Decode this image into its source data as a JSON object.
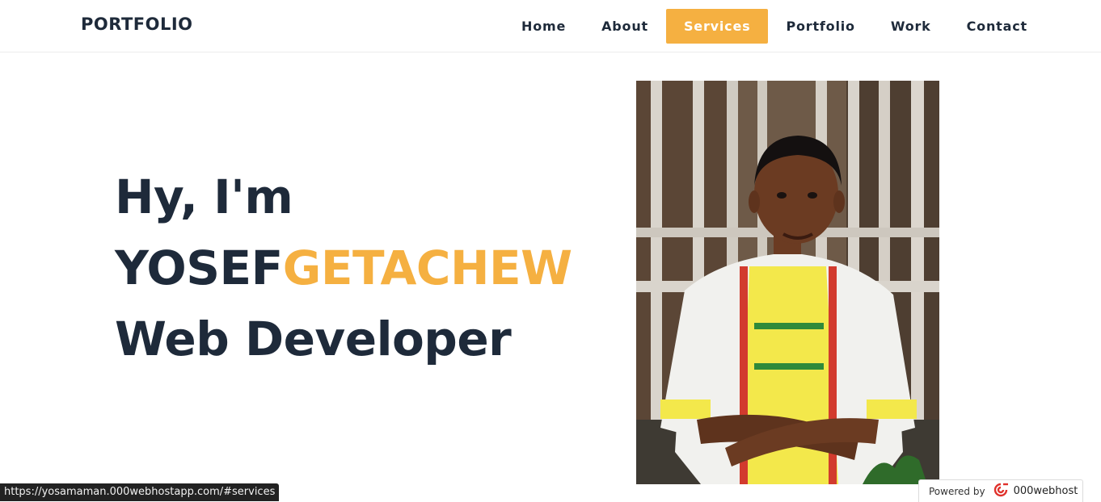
{
  "header": {
    "brand": "PORTFOLIO",
    "nav": [
      {
        "label": "Home",
        "active": false
      },
      {
        "label": "About",
        "active": false
      },
      {
        "label": "Services",
        "active": true
      },
      {
        "label": "Portfolio",
        "active": false
      },
      {
        "label": "Work",
        "active": false
      },
      {
        "label": "Contact",
        "active": false
      }
    ]
  },
  "hero": {
    "greeting": "Hy, I'm",
    "first_name": "YOSEF",
    "last_name": "GETACHEW",
    "role": "Web Developer"
  },
  "status_bar": {
    "url": "https://yosamaman.000webhostapp.com/#services"
  },
  "badge": {
    "powered_by": "Powered by",
    "host_name": "000webhost"
  },
  "colors": {
    "accent": "#f5b041",
    "text": "#1e2a3a"
  }
}
